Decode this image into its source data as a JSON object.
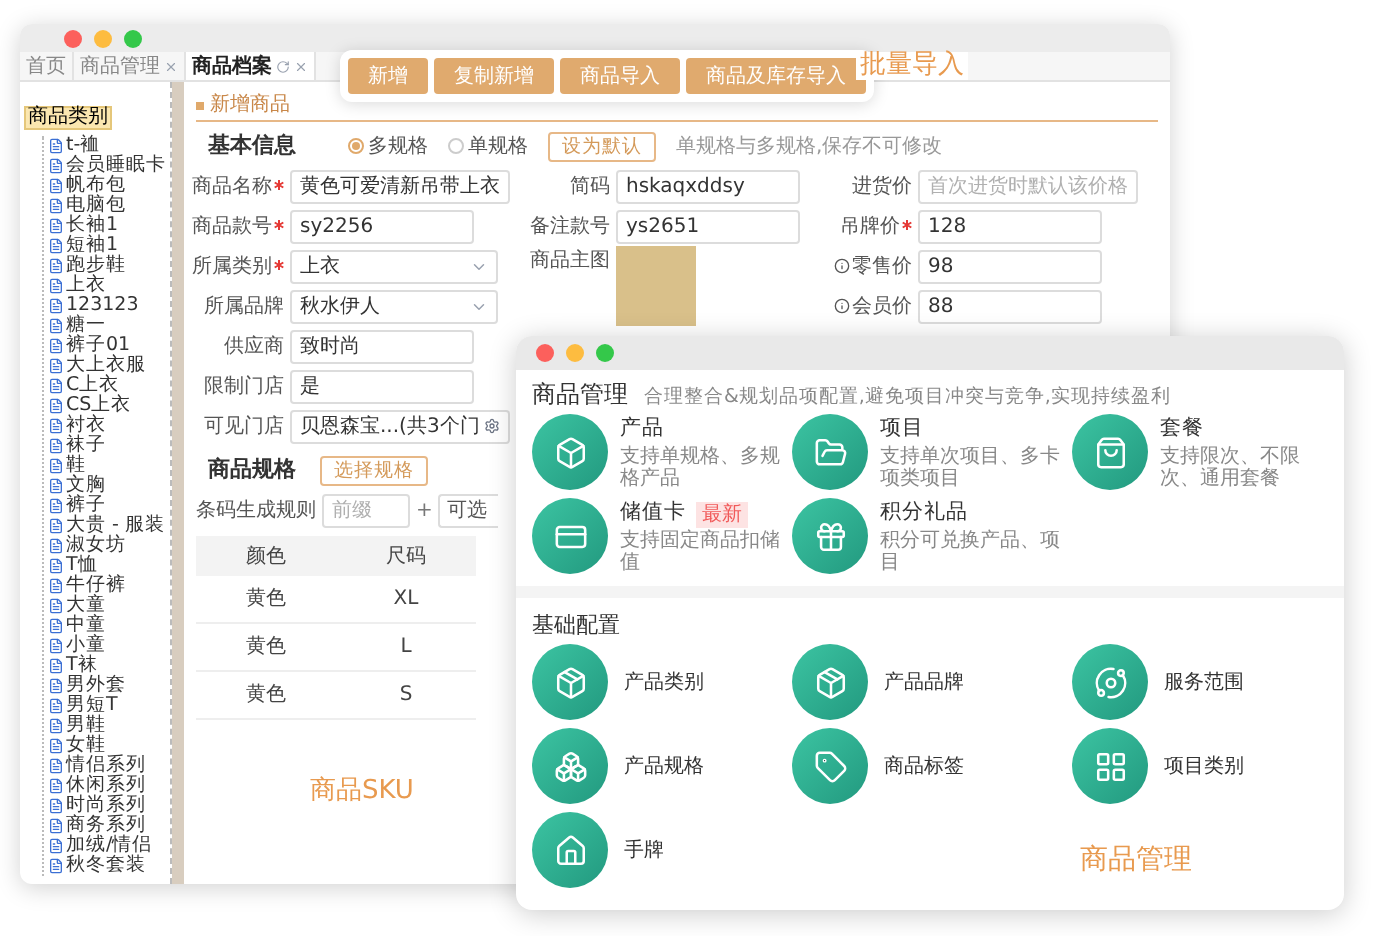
{
  "main_window": {
    "tabs": [
      {
        "label": "首页",
        "selected": false,
        "closable": false,
        "refreshable": false
      },
      {
        "label": "商品管理",
        "selected": false,
        "closable": true,
        "refreshable": false
      },
      {
        "label": "商品档案",
        "selected": true,
        "closable": true,
        "refreshable": true
      }
    ],
    "tree": {
      "label": "商品类别",
      "selected": true,
      "children": [
        {
          "label": "t-裇",
          "selected": false
        },
        {
          "label": "会员睡眠卡",
          "selected": false
        },
        {
          "label": "帆布包",
          "selected": false
        },
        {
          "label": "电脑包",
          "selected": false
        },
        {
          "label": "长袖1",
          "selected": false
        },
        {
          "label": "短袖1",
          "selected": false
        },
        {
          "label": "跑步鞋",
          "selected": false
        },
        {
          "label": "上衣",
          "selected": false
        },
        {
          "label": "123123",
          "selected": false
        },
        {
          "label": "糖一",
          "selected": false
        },
        {
          "label": "裤子01",
          "selected": false
        },
        {
          "label": "大上衣服",
          "selected": false
        },
        {
          "label": "C上衣",
          "selected": false
        },
        {
          "label": "CS上衣",
          "selected": false
        },
        {
          "label": "衬衣",
          "selected": false
        },
        {
          "label": "袜子",
          "selected": false
        },
        {
          "label": "鞋",
          "selected": false
        },
        {
          "label": "文胸",
          "selected": false
        },
        {
          "label": "裤子",
          "selected": false
        },
        {
          "label": "大贵 - 服装",
          "selected": false
        },
        {
          "label": "淑女坊",
          "selected": false
        },
        {
          "label": "T恤",
          "selected": false
        },
        {
          "label": "牛仔裤",
          "selected": false
        },
        {
          "label": "大童",
          "selected": false
        },
        {
          "label": "中童",
          "selected": false
        },
        {
          "label": "小童",
          "selected": false
        },
        {
          "label": "T袜",
          "selected": false
        },
        {
          "label": "男外套",
          "selected": false
        },
        {
          "label": "男短T",
          "selected": false
        },
        {
          "label": "男鞋",
          "selected": false
        },
        {
          "label": "女鞋",
          "selected": false
        },
        {
          "label": "情侣系列",
          "selected": false
        },
        {
          "label": "休闲系列",
          "selected": false
        },
        {
          "label": "时尚系列",
          "selected": false
        },
        {
          "label": "商务系列",
          "selected": false
        },
        {
          "label": "加绒/情侣",
          "selected": false
        },
        {
          "label": "秋冬套装",
          "selected": false
        }
      ]
    },
    "form": {
      "header": "新增商品",
      "basic_title": "基本信息",
      "spec_options": [
        {
          "label": "多规格",
          "selected": true
        },
        {
          "label": "单规格",
          "selected": false
        }
      ],
      "default_button": "设为默认",
      "hint": "单规格与多规格,保存不可修改",
      "columns": [
        [
          {
            "label": "商品名称",
            "required": true,
            "info": false,
            "kind": "input",
            "value": "黄色可爱清新吊带上衣"
          },
          {
            "label": "商品款号",
            "required": true,
            "info": false,
            "kind": "input",
            "value": "sy2256"
          },
          {
            "label": "所属类别",
            "required": true,
            "info": false,
            "kind": "select",
            "value": "上衣"
          },
          {
            "label": "所属品牌",
            "required": false,
            "info": false,
            "kind": "select",
            "value": "秋水伊人"
          },
          {
            "label": "供应商",
            "required": false,
            "info": false,
            "kind": "input",
            "value": "致时尚"
          },
          {
            "label": "限制门店",
            "required": false,
            "info": false,
            "kind": "input",
            "value": "是"
          },
          {
            "label": "可见门店",
            "required": false,
            "info": false,
            "kind": "picker",
            "value": "贝恩森宝...(共3个门"
          }
        ],
        [
          {
            "label": "简码",
            "required": false,
            "info": false,
            "kind": "input",
            "value": "hskaqxddsy"
          },
          {
            "label": "备注款号",
            "required": false,
            "info": false,
            "kind": "input",
            "value": "ys2651"
          },
          {
            "label": "商品主图",
            "required": false,
            "info": false,
            "kind": "photo"
          }
        ],
        [
          {
            "label": "进货价",
            "required": false,
            "info": false,
            "kind": "input",
            "placeholder": "首次进货时默认该价格"
          },
          {
            "label": "吊牌价",
            "required": true,
            "info": false,
            "kind": "input",
            "value": "128"
          },
          {
            "label": "零售价",
            "required": false,
            "info": true,
            "kind": "input",
            "value": "98"
          },
          {
            "label": "会员价",
            "required": false,
            "info": true,
            "kind": "input",
            "value": "88"
          }
        ]
      ]
    },
    "spec": {
      "title": "商品规格",
      "button": "选择规格",
      "barcode_label": "条码生成规则",
      "prefix_placeholder": "前缀",
      "separator": "+",
      "optional": "可选"
    },
    "sku_table": {
      "columns": [
        "颜色",
        "尺码"
      ],
      "rows": [
        [
          "黄色",
          "XL"
        ],
        [
          "黄色",
          "L"
        ],
        [
          "黄色",
          "S"
        ]
      ]
    }
  },
  "toolbar": {
    "buttons": [
      "新增",
      "复制新增",
      "商品导入",
      "商品及库存导入"
    ],
    "caption": "批量导入"
  },
  "sku_caption": "商品SKU",
  "manage_window": {
    "title": "商品管理",
    "subtitle": "合理整合&规划品项配置,避免项目冲突与竞争,实现持续盈利",
    "items": [
      {
        "title": "产品",
        "desc": "支持单规格、多规格产品"
      },
      {
        "title": "项目",
        "desc": "支持单次项目、多卡项类项目"
      },
      {
        "title": "套餐",
        "desc": "支持限次、不限次、通用套餐"
      },
      {
        "title": "储值卡",
        "badge": "最新",
        "desc": "支持固定商品扣储值"
      },
      {
        "title": "积分礼品",
        "desc": "积分可兑换产品、项目"
      }
    ],
    "config_title": "基础配置",
    "config_items": [
      {
        "title": "产品类别"
      },
      {
        "title": "产品品牌"
      },
      {
        "title": "服务范围"
      },
      {
        "title": "产品规格"
      },
      {
        "title": "商品标签"
      },
      {
        "title": "项目类别"
      },
      {
        "title": "手牌"
      }
    ],
    "caption": "商品管理"
  }
}
